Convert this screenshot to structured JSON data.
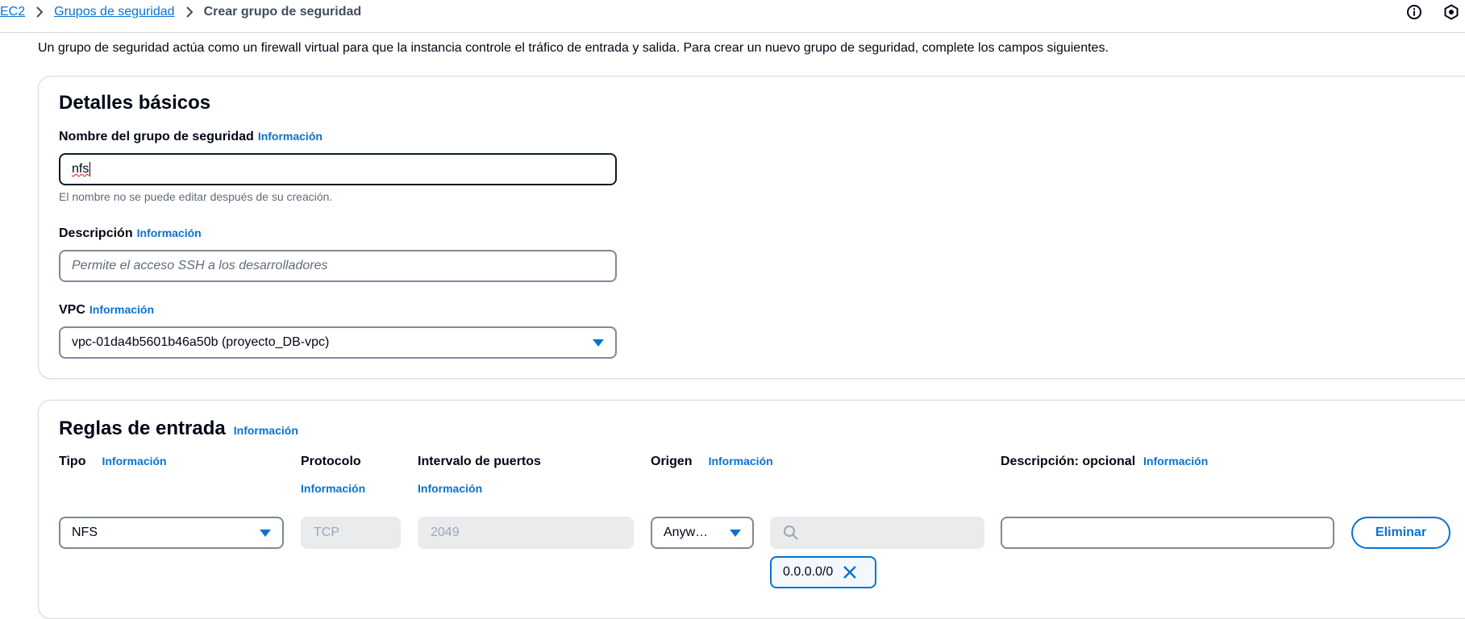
{
  "breadcrumb": {
    "root": "EC2",
    "parent": "Grupos de seguridad",
    "current": "Crear grupo de seguridad"
  },
  "header_icons": [
    "info-circle-icon",
    "settings-hexagon-icon"
  ],
  "intro_text": "Un grupo de seguridad actúa como un firewall virtual para que la instancia controle el tráfico de entrada y salida. Para crear un nuevo grupo de seguridad, complete los campos siguientes.",
  "basic": {
    "title": "Detalles básicos",
    "name_label": "Nombre del grupo de seguridad",
    "info": "Información",
    "name_value": "nfs",
    "name_hint": "El nombre no se puede editar después de su creación.",
    "description_label": "Descripción",
    "description_placeholder": "Permite el acceso SSH a los desarrolladores",
    "vpc_label": "VPC",
    "vpc_value": "vpc-01da4b5601b46a50b (proyecto_DB-vpc)"
  },
  "inbound": {
    "title": "Reglas de entrada",
    "info": "Información",
    "columns": {
      "type": "Tipo",
      "protocol": "Protocolo",
      "port_range": "Intervalo de puertos",
      "source": "Origen",
      "description": "Descripción: opcional"
    },
    "rule": {
      "type": "NFS",
      "protocol": "TCP",
      "port_range": "2049",
      "source_select": "Anyw…",
      "source_search_placeholder": "",
      "cidr_token": "0.0.0.0/0",
      "description": "",
      "delete_label": "Eliminar"
    }
  },
  "colors": {
    "link": "#0972d3",
    "text": "#000716",
    "muted": "#5f6b7a",
    "border": "#7d8998",
    "disabled_bg": "#e9ebed"
  }
}
